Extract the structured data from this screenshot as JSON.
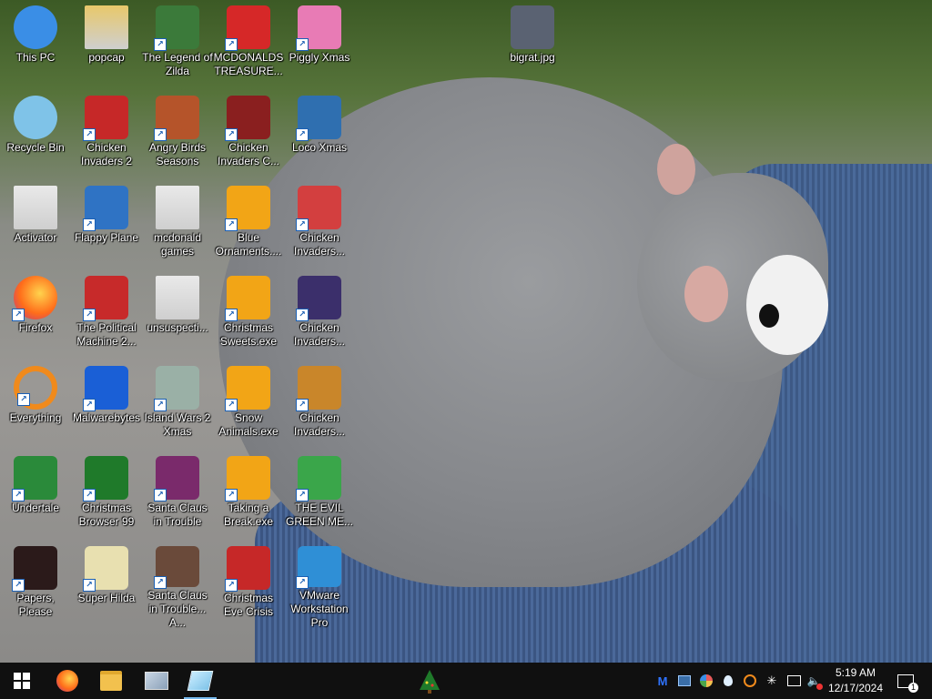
{
  "desktop_icons": [
    {
      "label": "This PC",
      "icon": "computer-icon",
      "color": "#3a8ee6"
    },
    {
      "label": "popcap",
      "icon": "folder-icon",
      "color": "#e8c86a"
    },
    {
      "label": "The Legend of Zilda",
      "icon": "game-icon",
      "color": "#3b7a3a"
    },
    {
      "label": "MCDONALDS TREASURE...",
      "icon": "game-icon",
      "color": "#d62828"
    },
    {
      "label": "Piggly Xmas",
      "icon": "game-icon",
      "color": "#e87bb5"
    },
    {
      "label": "bigrat.jpg",
      "icon": "image-file-icon",
      "color": "#5a6272"
    },
    {
      "label": "Recycle Bin",
      "icon": "recycle-bin-icon",
      "color": "#7fc3e8"
    },
    {
      "label": "Chicken Invaders 2",
      "icon": "game-icon",
      "color": "#c62828"
    },
    {
      "label": "Angry Birds Seasons",
      "icon": "game-icon",
      "color": "#b5542a"
    },
    {
      "label": "Chicken Invaders C...",
      "icon": "game-icon",
      "color": "#8a1f1f"
    },
    {
      "label": "Loco Xmas",
      "icon": "game-icon",
      "color": "#2f6fb0"
    },
    {
      "label": "Activator",
      "icon": "folder-icon",
      "color": "#e9e9e9"
    },
    {
      "label": "Flappy Plane",
      "icon": "game-icon",
      "color": "#2f73c4"
    },
    {
      "label": "mcdonald games",
      "icon": "folder-icon",
      "color": "#e9e9e9"
    },
    {
      "label": "Blue Ornaments....",
      "icon": "game-icon",
      "color": "#f2a516"
    },
    {
      "label": "Chicken Invaders...",
      "icon": "game-icon",
      "color": "#d33f3f"
    },
    {
      "label": "Firefox",
      "icon": "firefox-icon",
      "color": "#ff6d1a"
    },
    {
      "label": "The Political Machine 2...",
      "icon": "game-icon",
      "color": "#c72a2a"
    },
    {
      "label": "unsuspecti...",
      "icon": "folder-icon",
      "color": "#e9e9e9"
    },
    {
      "label": "Christmas Sweets.exe",
      "icon": "game-icon",
      "color": "#f2a516"
    },
    {
      "label": "Chicken Invaders...",
      "icon": "game-icon",
      "color": "#3b2f6b"
    },
    {
      "label": "Everything",
      "icon": "search-icon",
      "color": "#f08a1c"
    },
    {
      "label": "Malwarebytes",
      "icon": "malwarebytes-icon",
      "color": "#1a5fd6"
    },
    {
      "label": "Island Wars 2 Xmas",
      "icon": "game-icon",
      "color": "#9ab0a6"
    },
    {
      "label": "Snow Animals.exe",
      "icon": "game-icon",
      "color": "#f2a516"
    },
    {
      "label": "Chicken Invaders...",
      "icon": "game-icon",
      "color": "#c9862a"
    },
    {
      "label": "Undertale",
      "icon": "game-icon",
      "color": "#2a8a3a"
    },
    {
      "label": "Christmas Browser 99",
      "icon": "tree-icon",
      "color": "#1f7a2a"
    },
    {
      "label": "Santa Claus in Trouble",
      "icon": "game-icon",
      "color": "#7a2a6b"
    },
    {
      "label": "Taking a Break.exe",
      "icon": "game-icon",
      "color": "#f2a516"
    },
    {
      "label": "THE EVIL GREEN ME...",
      "icon": "messenger-icon",
      "color": "#3aa64a"
    },
    {
      "label": "Papers, Please",
      "icon": "game-icon",
      "color": "#2b1a1a"
    },
    {
      "label": "Super Hilda",
      "icon": "game-icon",
      "color": "#e8e0b0"
    },
    {
      "label": "Santa Claus in Trouble... A...",
      "icon": "game-icon",
      "color": "#6a4a3a"
    },
    {
      "label": "Christmas Eve Crisis",
      "icon": "game-icon",
      "color": "#c62828"
    },
    {
      "label": "VMware Workstation Pro",
      "icon": "vmware-icon",
      "color": "#2f8fd6"
    }
  ],
  "taskbar": {
    "start_label": "Start",
    "pinned": [
      {
        "name": "firefox",
        "color": "#ff6d1a"
      },
      {
        "name": "file-explorer",
        "color": "#f2c14e"
      },
      {
        "name": "photos",
        "color": "#8aa0b8"
      },
      {
        "name": "notepad",
        "color": "#7fc3e8"
      }
    ],
    "center_app": {
      "name": "christmas-browser",
      "color": "#1f7a2a"
    },
    "tray_icons": [
      "malwarebytes-icon",
      "display-icon",
      "network-apps-icon",
      "droplet-icon",
      "search-icon",
      "sparkle-icon",
      "network-icon",
      "volume-muted-icon"
    ],
    "time": "5:19 AM",
    "date": "12/17/2024",
    "notifications_count": "1"
  },
  "colors": {
    "taskbar_bg": "#101010",
    "accent": "#76b9ed"
  }
}
